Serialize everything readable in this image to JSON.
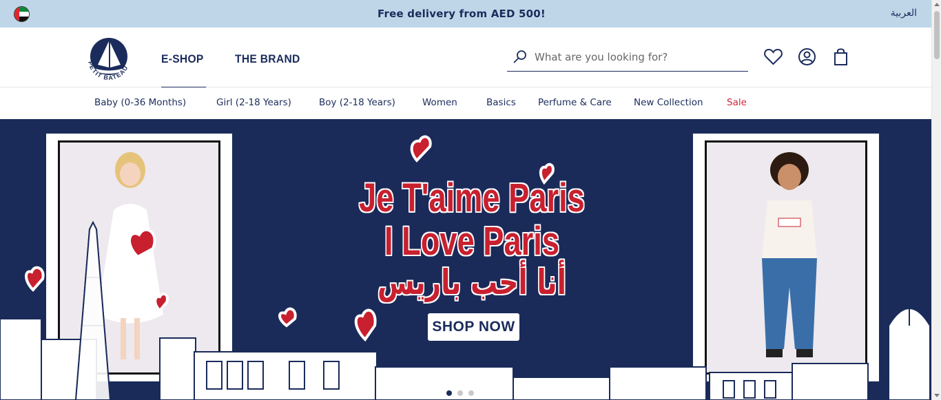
{
  "promo": {
    "message": "Free delivery from AED 500!",
    "language_link": "العربية",
    "flag": "uae-flag-icon"
  },
  "header": {
    "logo_text": "PETIT BATEAU",
    "nav": [
      {
        "label": "E-SHOP",
        "active": true
      },
      {
        "label": "THE BRAND",
        "active": false
      }
    ],
    "search": {
      "placeholder": "What are you looking for?",
      "value": ""
    },
    "icons": [
      "heart-icon",
      "user-icon",
      "shopping-bag-icon"
    ]
  },
  "categories": [
    {
      "label": "Baby (0-36 Months)"
    },
    {
      "label": "Girl (2-18 Years)"
    },
    {
      "label": "Boy (2-18 Years)"
    },
    {
      "label": "Women"
    },
    {
      "label": "Basics"
    },
    {
      "label": "Perfume & Care"
    },
    {
      "label": "New Collection"
    },
    {
      "label": "Sale"
    }
  ],
  "hero": {
    "line1": "Je T'aime Paris",
    "line2": "I Love Paris",
    "line3": "أنا أحب باريس",
    "cta": "SHOP NOW",
    "slide_count": 3,
    "active_slide": 1
  },
  "colors": {
    "navy": "#1b2c5c",
    "promo_bg": "#bfd6e8",
    "accent_red": "#c8202f",
    "sale_red": "#d2243b"
  }
}
